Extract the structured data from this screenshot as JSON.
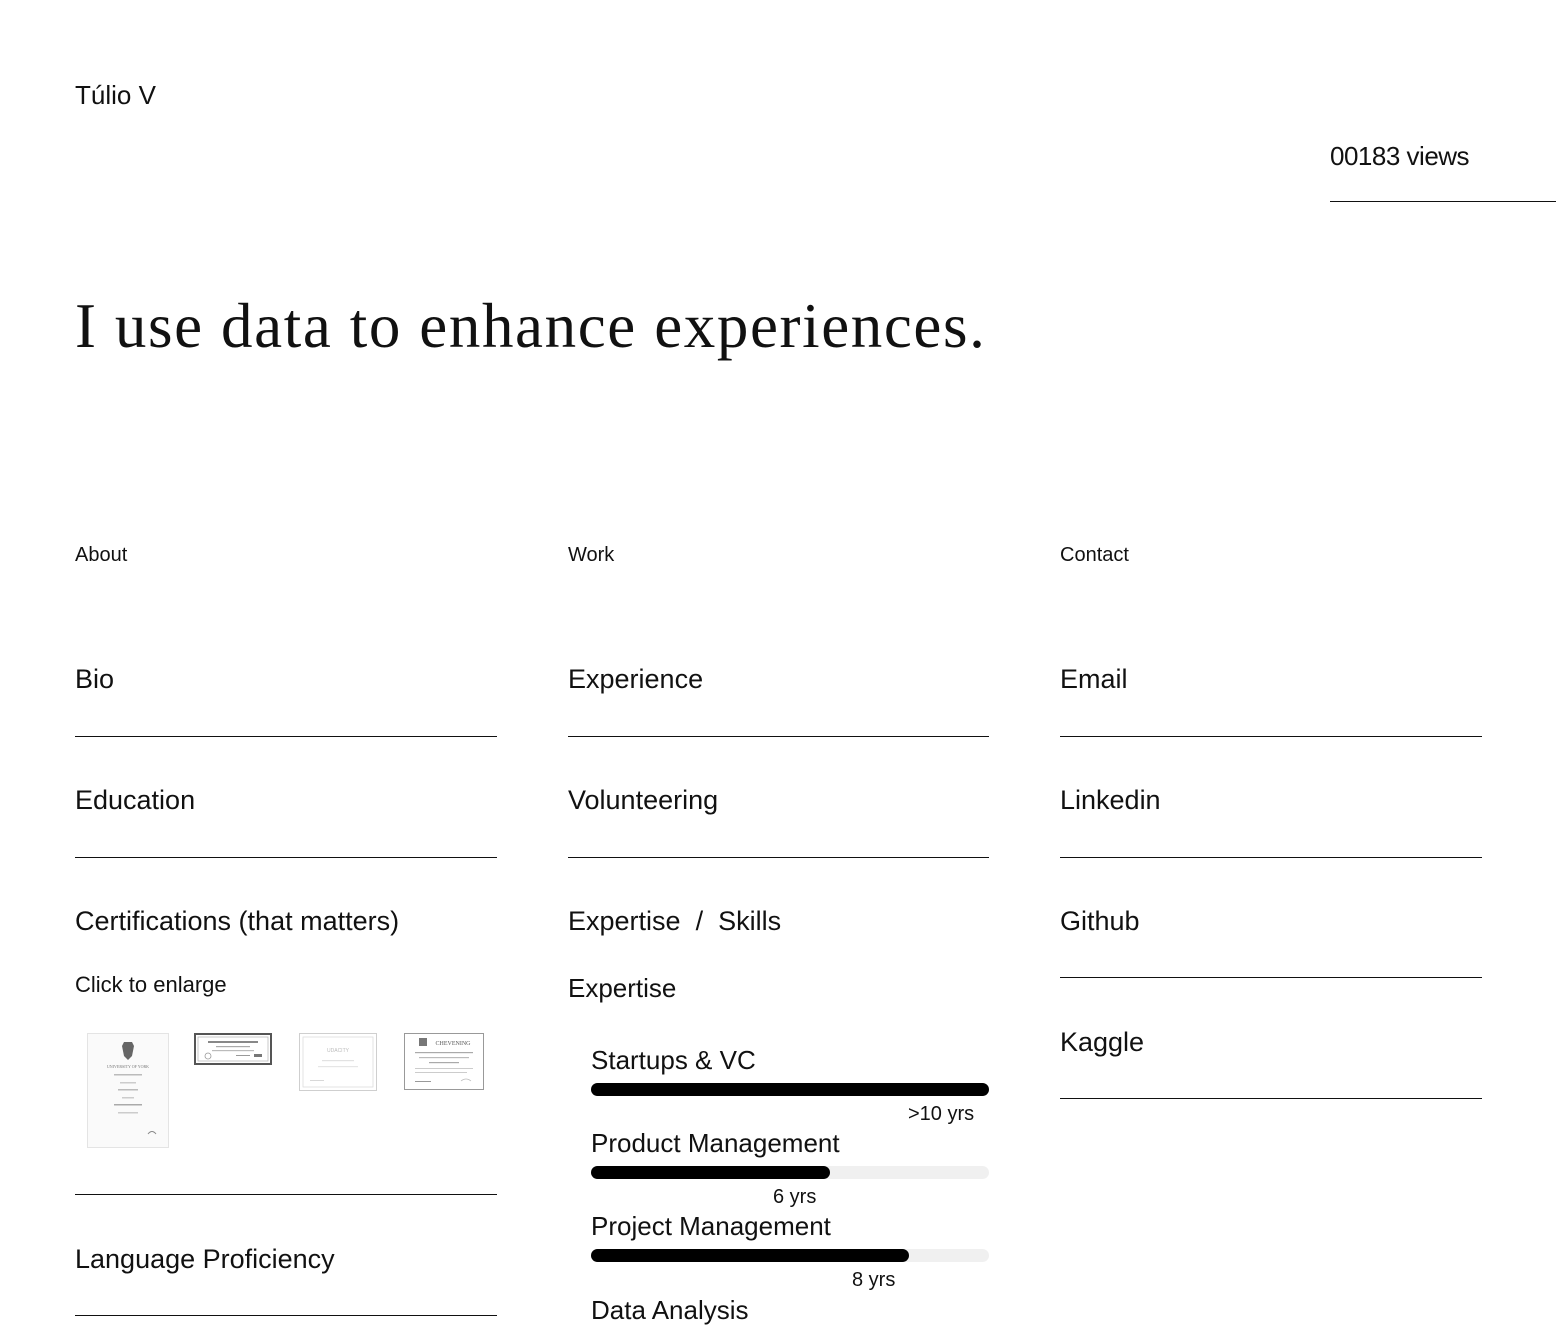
{
  "site": {
    "name": "Túlio V"
  },
  "counter": {
    "value": "00183",
    "suffix": " views"
  },
  "hero": {
    "headline": "I use data to enhance experiences."
  },
  "columns": {
    "about": {
      "label": "About",
      "items": [
        "Bio",
        "Education",
        "Certifications (that matters)",
        "Language Proficiency"
      ],
      "certifications_hint": "Click to enlarge",
      "certificate_thumbnails": [
        {
          "name": "University certificate",
          "heading": "UNIVERSITY OF YORK"
        },
        {
          "name": "Framed certificate",
          "heading": ""
        },
        {
          "name": "Udacity certificate",
          "heading": "UDACITY"
        },
        {
          "name": "Chevening certificate",
          "heading": "CHEVENING"
        }
      ]
    },
    "work": {
      "label": "Work",
      "items": [
        "Experience",
        "Volunteering"
      ],
      "expertise_skills": {
        "expertise_label": "Expertise",
        "separator": "/",
        "skills_label": "Skills"
      },
      "expertise_heading": "Expertise",
      "skills": [
        {
          "name": "Startups & VC",
          "years_label": ">10 yrs",
          "level": 1.0
        },
        {
          "name": "Product Management",
          "years_label": "6 yrs",
          "level": 0.6
        },
        {
          "name": "Project Management",
          "years_label": "8 yrs",
          "level": 0.8
        },
        {
          "name": "Data Analysis",
          "years_label": "",
          "level": null
        }
      ]
    },
    "contact": {
      "label": "Contact",
      "items": [
        "Email",
        "Linkedin",
        "Github",
        "Kaggle"
      ]
    }
  }
}
